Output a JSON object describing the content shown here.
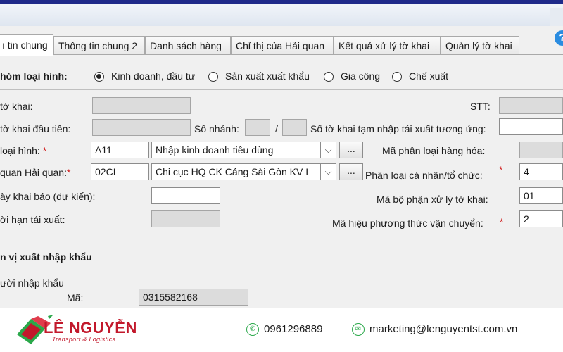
{
  "tabs": [
    {
      "label": "Thông tin chung",
      "visible": "ı tin chung",
      "active": true
    },
    {
      "label": "Thông tin chung 2"
    },
    {
      "label": "Danh sách hàng"
    },
    {
      "label": "Chỉ thị của Hải quan"
    },
    {
      "label": "Kết quả xử lý tờ khai"
    },
    {
      "label": "Quản lý tờ khai"
    }
  ],
  "help_icon": "?",
  "group": {
    "label": "hóm loại hình:",
    "options": [
      {
        "label": "Kinh doanh, đầu tư",
        "selected": true
      },
      {
        "label": "Sản xuất xuất khẩu",
        "selected": false
      },
      {
        "label": "Gia công",
        "selected": false
      },
      {
        "label": "Chế xuất",
        "selected": false
      }
    ]
  },
  "fields": {
    "so_to_khai_label": "tờ khai:",
    "stt_label": "STT:",
    "to_khai_dau_tien_label": "tờ khai đầu tiên:",
    "so_nhanh_label": "Số nhánh:",
    "slash": "/",
    "tam_nhap_label": "Số tờ khai tạm nhập tái xuất tương ứng:",
    "loai_hinh_label": "loại hình:",
    "loai_hinh_code": "A11",
    "loai_hinh_name": "Nhập kinh doanh tiêu dùng",
    "ma_phan_loai_hang_label": "Mã phân loại hàng hóa:",
    "co_quan_label": "quan Hải quan:",
    "co_quan_code": "02CI",
    "co_quan_name": "Chi cục HQ CK Cảng Sài Gòn KV I",
    "phan_loai_ca_nhan_label": "Phân loại cá nhân/tổ chức:",
    "phan_loai_ca_nhan_value": "4",
    "ngay_khai_bao_label": "ày khai báo (dự kiến):",
    "bo_phan_xu_ly_label": "Mã bộ phận xử lý tờ khai:",
    "bo_phan_xu_ly_value": "01",
    "thoi_han_label": "ời hạn tái xuất:",
    "phuong_thuc_label": "Mã hiệu phương thức vận chuyển:",
    "phuong_thuc_value": "2",
    "required_mark": "*",
    "dots": "...",
    "arrow": "⌵"
  },
  "section": {
    "title": "n vị xuất nhập khẩu",
    "sub": "ười nhập khẩu",
    "ma_label": "Mã:",
    "ma_value": "0315582168"
  },
  "footer": {
    "brand": "LÊ NGUYỄN",
    "brand_sub": "Transport & Logistics",
    "phone": "0961296889",
    "email": "marketing@lenguyentst.com.vn",
    "brand_color": "#c2182b",
    "accent_color": "#2aa84a"
  }
}
